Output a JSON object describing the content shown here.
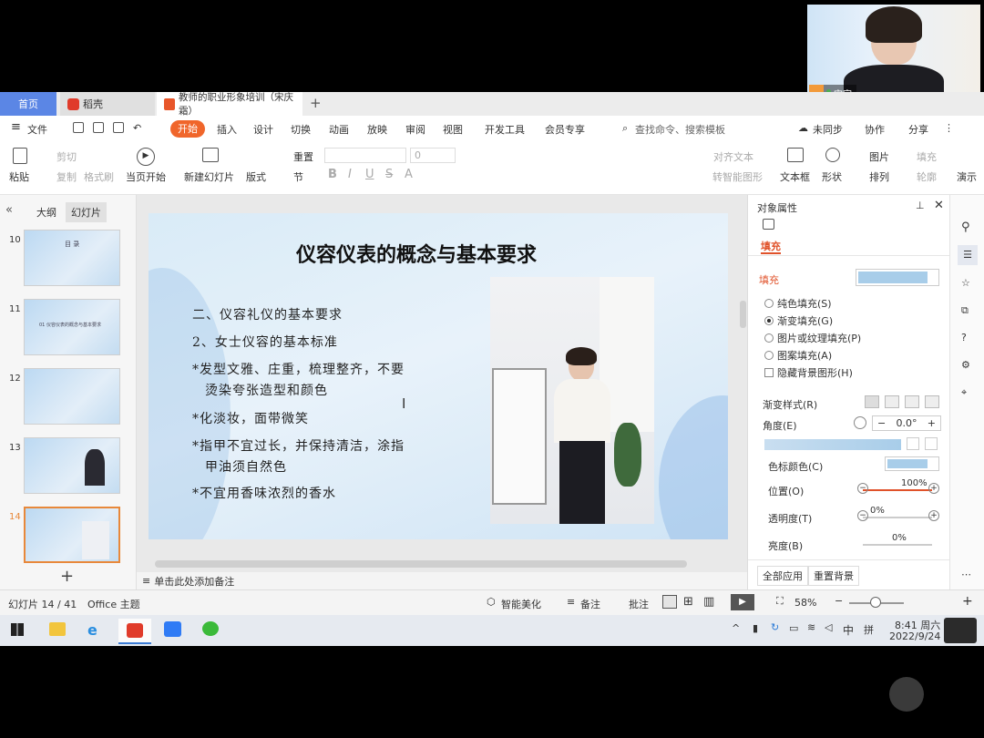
{
  "tabs": {
    "home": "首页",
    "dk": "稻壳",
    "doc": "教师的职业形象培训（宋庆霜）"
  },
  "video": {
    "name": "宋宗"
  },
  "menu": {
    "file": "文件",
    "start": "开始",
    "insert": "插入",
    "design": "设计",
    "switch": "切换",
    "animation": "动画",
    "play": "放映",
    "review": "审阅",
    "view": "视图",
    "dev": "开发工具",
    "vip": "会员专享",
    "search": "查找命令、搜索模板",
    "sync": "未同步",
    "collab": "协作",
    "share": "分享"
  },
  "toolbar": {
    "paste": "粘贴",
    "cut": "剪切",
    "copy": "复制",
    "format_brush": "格式刷",
    "from_current": "当页开始",
    "new_slide": "新建幻灯片",
    "layout": "版式",
    "section": "节",
    "reset": "重置",
    "font_size": "0",
    "align_text": "对齐文本",
    "to_smartart": "转智能图形",
    "textbox": "文本框",
    "shape": "形状",
    "picture": "图片",
    "arrange": "排列",
    "fill": "填充",
    "outline": "轮廓",
    "present": "演示"
  },
  "left_panel": {
    "outline_tab": "大纲",
    "slides_tab": "幻灯片",
    "numbers": [
      "10",
      "11",
      "12",
      "13",
      "14"
    ],
    "thumb10_title": "目 录",
    "thumb11_text": "01 仪容仪表的概念与基本要求"
  },
  "slide": {
    "title": "仪容仪表的概念与基本要求",
    "lines": [
      "二、仪容礼仪的基本要求",
      "2、女士仪容的基本标准",
      "*发型文雅、庄重，梳理整齐，不要",
      "烫染夸张造型和颜色",
      "*化淡妆，面带微笑",
      "*指甲不宜过长，并保持清洁，涂指",
      "甲油须自然色",
      "*不宜用香味浓烈的香水"
    ]
  },
  "notes_placeholder": "单击此处添加备注",
  "right_panel": {
    "title": "对象属性",
    "fill_tab": "填充",
    "fill_section": "填充",
    "options": [
      "纯色填充(S)",
      "渐变填充(G)",
      "图片或纹理填充(P)",
      "图案填充(A)"
    ],
    "hide_bg": "隐藏背景图形(H)",
    "gradient_style": "渐变样式(R)",
    "angle_label": "角度(E)",
    "angle_value": "0.0°",
    "stop_color": "色标颜色(C)",
    "position_label": "位置(O)",
    "position_value": "100%",
    "transparency_label": "透明度(T)",
    "transparency_value": "0%",
    "brightness_label": "亮度(B)",
    "brightness_value": "0%",
    "apply_all": "全部应用",
    "reset_bg": "重置背景",
    "fill_color": "#a8cde9"
  },
  "status": {
    "slide_count": "幻灯片 14 / 41",
    "theme": "Office 主题",
    "beautify": "智能美化",
    "notes": "备注",
    "comments": "批注",
    "zoom": "58%"
  },
  "taskbar": {
    "time": "8:41 周六",
    "date": "2022/9/24",
    "ime": "中",
    "ime2": "拼"
  }
}
